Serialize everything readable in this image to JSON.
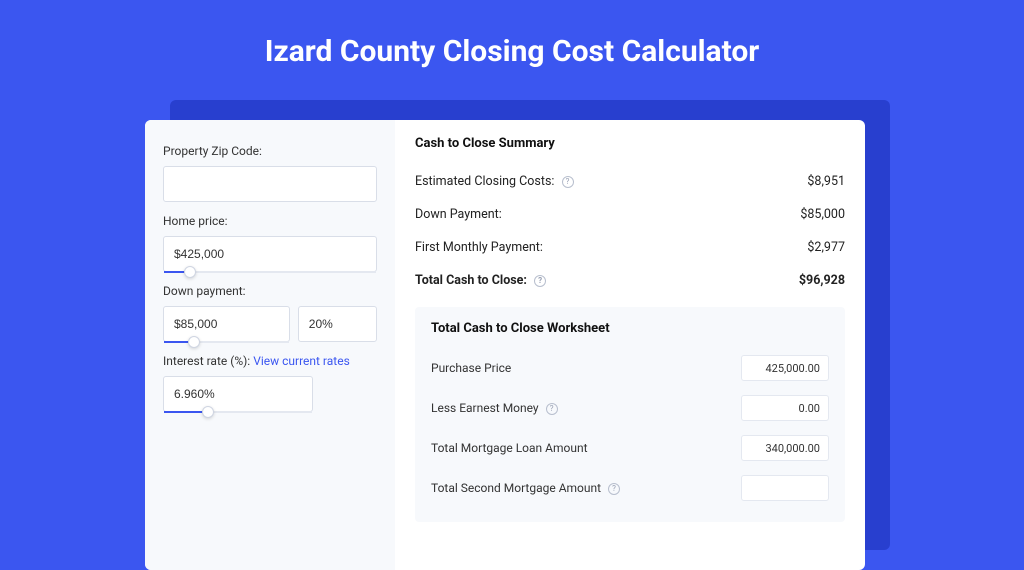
{
  "page": {
    "title": "Izard County Closing Cost Calculator"
  },
  "sidebar": {
    "zip": {
      "label": "Property Zip Code:",
      "value": ""
    },
    "home_price": {
      "label": "Home price:",
      "value": "$425,000",
      "slider_pct": 10
    },
    "down_payment": {
      "label": "Down payment:",
      "amount": "$85,000",
      "percent": "20%",
      "slider_pct": 20
    },
    "interest": {
      "label": "Interest rate (%): ",
      "link": "View current rates",
      "value": "6.960%",
      "slider_pct": 26
    }
  },
  "summary": {
    "title": "Cash to Close Summary",
    "rows": [
      {
        "label": "Estimated Closing Costs:",
        "help": true,
        "value": "$8,951"
      },
      {
        "label": "Down Payment:",
        "help": false,
        "value": "$85,000"
      },
      {
        "label": "First Monthly Payment:",
        "help": false,
        "value": "$2,977"
      }
    ],
    "total": {
      "label": "Total Cash to Close:",
      "help": true,
      "value": "$96,928"
    }
  },
  "worksheet": {
    "title": "Total Cash to Close Worksheet",
    "rows": [
      {
        "label": "Purchase Price",
        "help": false,
        "value": "425,000.00"
      },
      {
        "label": "Less Earnest Money",
        "help": true,
        "value": "0.00"
      },
      {
        "label": "Total Mortgage Loan Amount",
        "help": false,
        "value": "340,000.00"
      },
      {
        "label": "Total Second Mortgage Amount",
        "help": true,
        "value": ""
      }
    ]
  }
}
